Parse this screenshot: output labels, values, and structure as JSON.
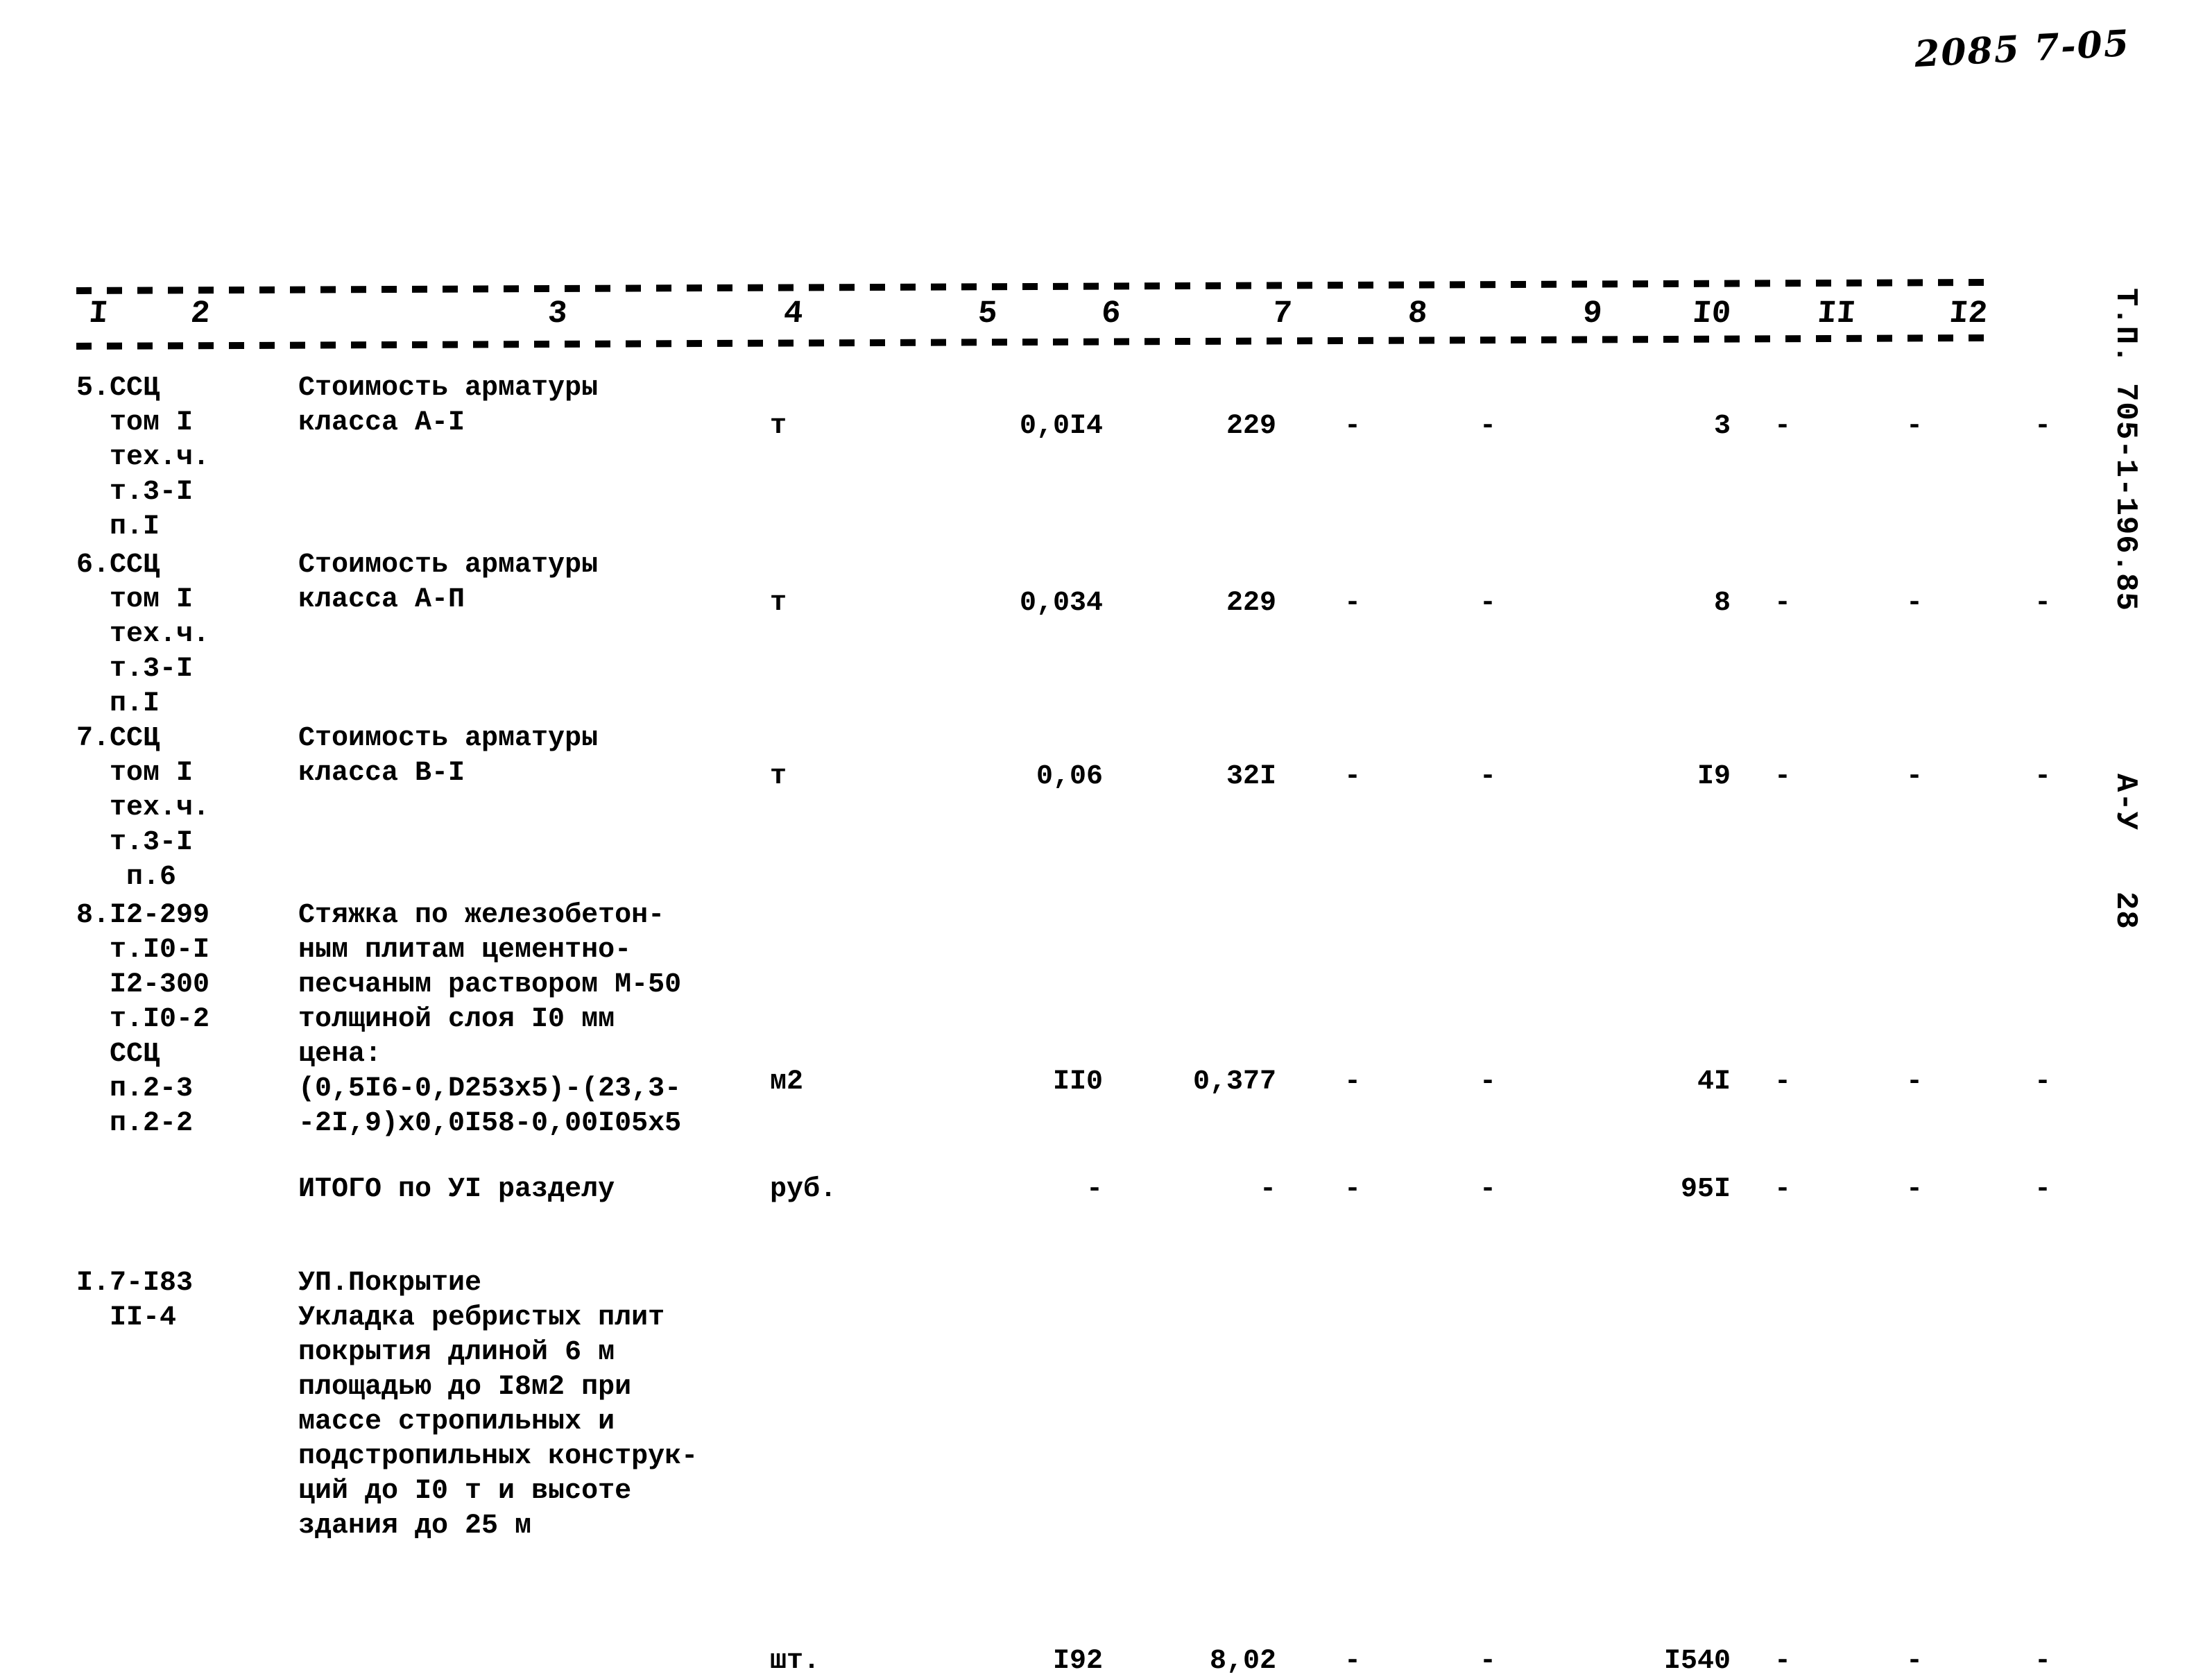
{
  "page": {
    "handwritten_note": "2085 7-05",
    "vertical_stamp": {
      "title": "Т.П. 705-1-196.85",
      "sheet_code": "А-У",
      "sheet_number": "28"
    }
  },
  "table": {
    "column_headers": [
      "I",
      "2",
      "3",
      "4",
      "5",
      "6",
      "7",
      "8",
      "9",
      "I0",
      "II",
      "I2"
    ],
    "rows": [
      {
        "codes": "5.ССЦ\n  том I\n  тех.ч.\n  т.3-I\n  п.I",
        "description": "Стоимость арматуры\nкласса А-I",
        "unit": "т",
        "c5": "0,0I4",
        "c6": "229",
        "c7": "-",
        "c8": "-",
        "c9": "3",
        "c10": "-",
        "c11": "-",
        "c12": "-"
      },
      {
        "codes": "6.ССЦ\n  том I\n  тех.ч.\n  т.3-I\n  п.I",
        "description": "Стоимость арматуры\nкласса А-П",
        "unit": "т",
        "c5": "0,034",
        "c6": "229",
        "c7": "-",
        "c8": "-",
        "c9": "8",
        "c10": "-",
        "c11": "-",
        "c12": "-"
      },
      {
        "codes": "7.ССЦ\n  том I\n  тех.ч.\n  т.3-I\n   п.6",
        "description": "Стоимость арматуры\nкласса В-I",
        "unit": "т",
        "c5": "0,06",
        "c6": "32I",
        "c7": "-",
        "c8": "-",
        "c9": "I9",
        "c10": "-",
        "c11": "-",
        "c12": "-"
      },
      {
        "codes": "8.I2-299\n  т.I0-I\n  I2-300\n  т.I0-2\n  ССЦ\n  п.2-3\n  п.2-2",
        "description": "Стяжка по железобетон-\nным плитам цементно-\nпесчаным раствором М-50\nтолщиной слоя I0 мм\nцена:\n(0,5I6-0,D253х5)-(23,3-\n-2I,9)х0,0I58-0,00I05х5",
        "unit": "м2",
        "c5": "II0",
        "c6": "0,377",
        "c7": "-",
        "c8": "-",
        "c9": "4I",
        "c10": "-",
        "c11": "-",
        "c12": "-"
      },
      {
        "codes": "",
        "description": "ИТОГО по УI разделу",
        "unit": "руб.",
        "c5": "-",
        "c6": "-",
        "c7": "-",
        "c8": "-",
        "c9": "95I",
        "c10": "-",
        "c11": "-",
        "c12": "-"
      },
      {
        "codes": "I.7-I83\n  II-4",
        "description": "УП.Покрытие\nУкладка ребристых плит\nпокрытия длиной 6 м\nплощадью до I8м2 при\nмассе стропильных и\nподстропильных конструк-\nций до I0 т и высоте\nздания до 25 м",
        "unit": "шт.",
        "c5": "I92",
        "c6": "8,02",
        "c7": "-",
        "c8": "-",
        "c9": "I540",
        "c10": "-",
        "c11": "-",
        "c12": "-"
      }
    ]
  }
}
